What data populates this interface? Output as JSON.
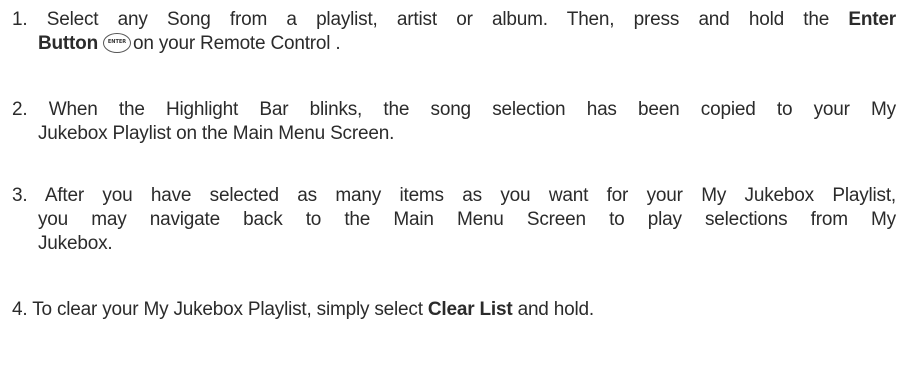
{
  "steps": [
    {
      "number": "1.",
      "line1": "Select any Song from a playlist, artist or album. Then, press and hold the",
      "bold1": "Enter",
      "bold2": "Button",
      "icon": "enter-button-icon",
      "icon_text": "ENTER",
      "line2_rest": "on your Remote Control ."
    },
    {
      "number": "2.",
      "line1": "When the Highlight Bar blinks, the song selection has been copied to your My",
      "line2": "Jukebox Playlist on the Main Menu Screen."
    },
    {
      "number": "3.",
      "line1": "After you have selected as many items as you want for your My Jukebox Playlist,",
      "line2": "you may navigate back to the Main Menu Screen to play selections from My",
      "line3": "Jukebox."
    },
    {
      "number": "4.",
      "text_before": "To clear your My Jukebox Playlist, simply select",
      "bold": "Clear List",
      "text_after": "and hold."
    }
  ]
}
